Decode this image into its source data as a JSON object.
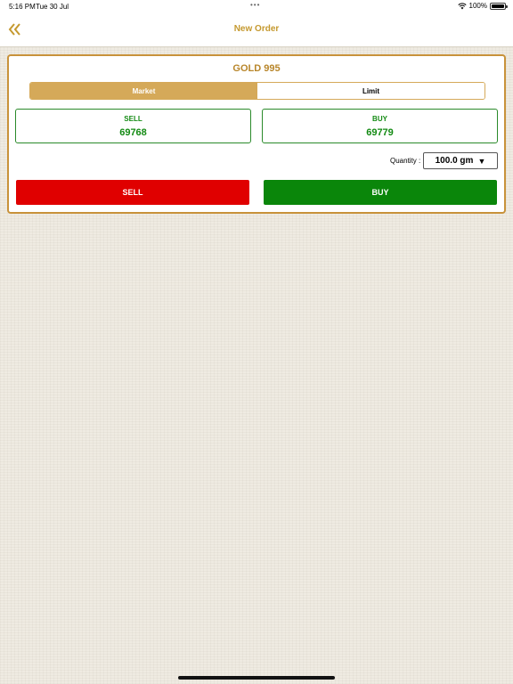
{
  "status_bar": {
    "time": "5:16 PM",
    "date": "Tue 30 Jul",
    "dots": "•••",
    "battery": "100%",
    "icons": [
      "wifi-icon",
      "battery-icon"
    ]
  },
  "nav": {
    "title": "New Order",
    "back_icon": "double-chevron-left-icon"
  },
  "order": {
    "instrument": "GOLD 995",
    "order_types": [
      {
        "label": "Market",
        "selected": true
      },
      {
        "label": "Limit",
        "selected": false
      }
    ],
    "sell_price": {
      "label": "SELL",
      "value": "69768"
    },
    "buy_price": {
      "label": "BUY",
      "value": "69779"
    },
    "quantity": {
      "label": "Quantity :",
      "value": "100.0 gm",
      "caret": "▼"
    },
    "sell_button": "SELL",
    "buy_button": "BUY"
  },
  "colors": {
    "accent_gold": "#c5992f",
    "segment_active": "#d5a959",
    "price_green": "#138a13",
    "sell_red": "#e00000",
    "buy_green": "#0a860a"
  }
}
